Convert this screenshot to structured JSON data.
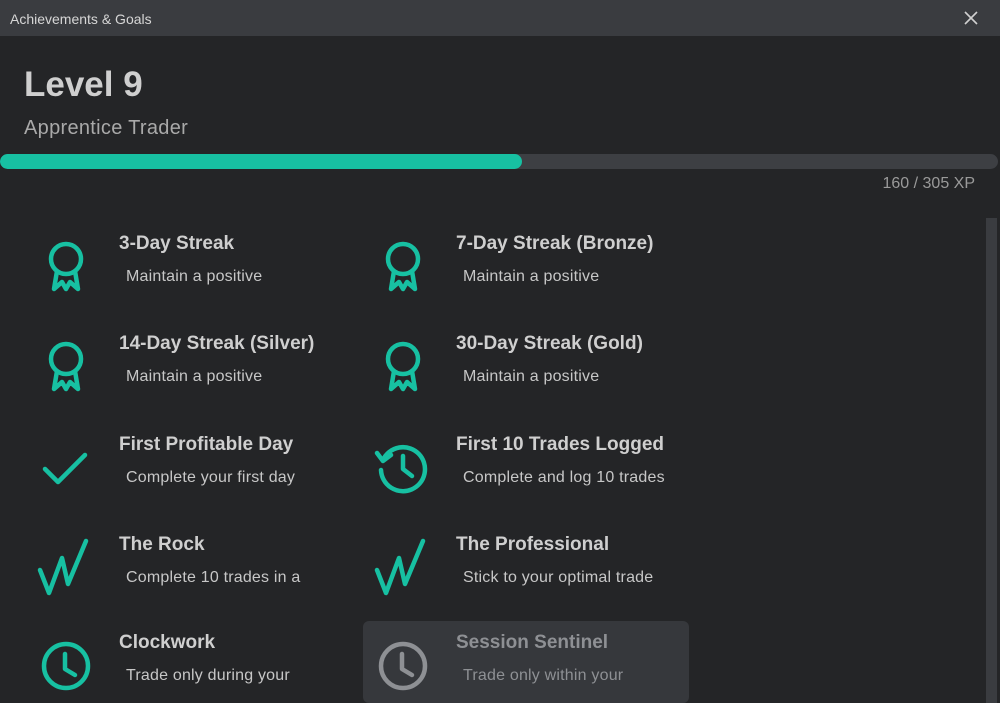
{
  "window": {
    "title": "Achievements & Goals"
  },
  "header": {
    "level": "Level 9",
    "rank": "Apprentice Trader",
    "xp_text": "160 / 305 XP",
    "xp_progress": 0.523
  },
  "colors": {
    "accent": "#17c0a2",
    "locked_icon": "#8e9094"
  },
  "achievements": [
    {
      "name": "3-Day Streak",
      "desc": "Maintain a positive",
      "icon": "ribbon-award-icon",
      "locked": false
    },
    {
      "name": "7-Day Streak (Bronze)",
      "desc": "Maintain a positive",
      "icon": "ribbon-award-icon",
      "locked": false
    },
    {
      "name": "14-Day Streak (Silver)",
      "desc": "Maintain a positive",
      "icon": "ribbon-award-icon",
      "locked": false
    },
    {
      "name": "30-Day Streak (Gold)",
      "desc": "Maintain a positive",
      "icon": "ribbon-award-icon",
      "locked": false
    },
    {
      "name": "First Profitable Day",
      "desc": "Complete your first day",
      "icon": "checkmark-icon",
      "locked": false
    },
    {
      "name": "First 10 Trades Logged",
      "desc": "Complete and log 10 trades",
      "icon": "history-clock-icon",
      "locked": false
    },
    {
      "name": "The Rock",
      "desc": "Complete 10 trades in a",
      "icon": "zigzag-trend-icon",
      "locked": false
    },
    {
      "name": "The Professional",
      "desc": "Stick to your optimal trade",
      "icon": "zigzag-trend-icon",
      "locked": false
    },
    {
      "name": "Clockwork",
      "desc": "Trade only during your",
      "icon": "clock-icon",
      "locked": false
    },
    {
      "name": "Session Sentinel",
      "desc": "Trade only within your",
      "icon": "clock-icon",
      "locked": true
    }
  ]
}
